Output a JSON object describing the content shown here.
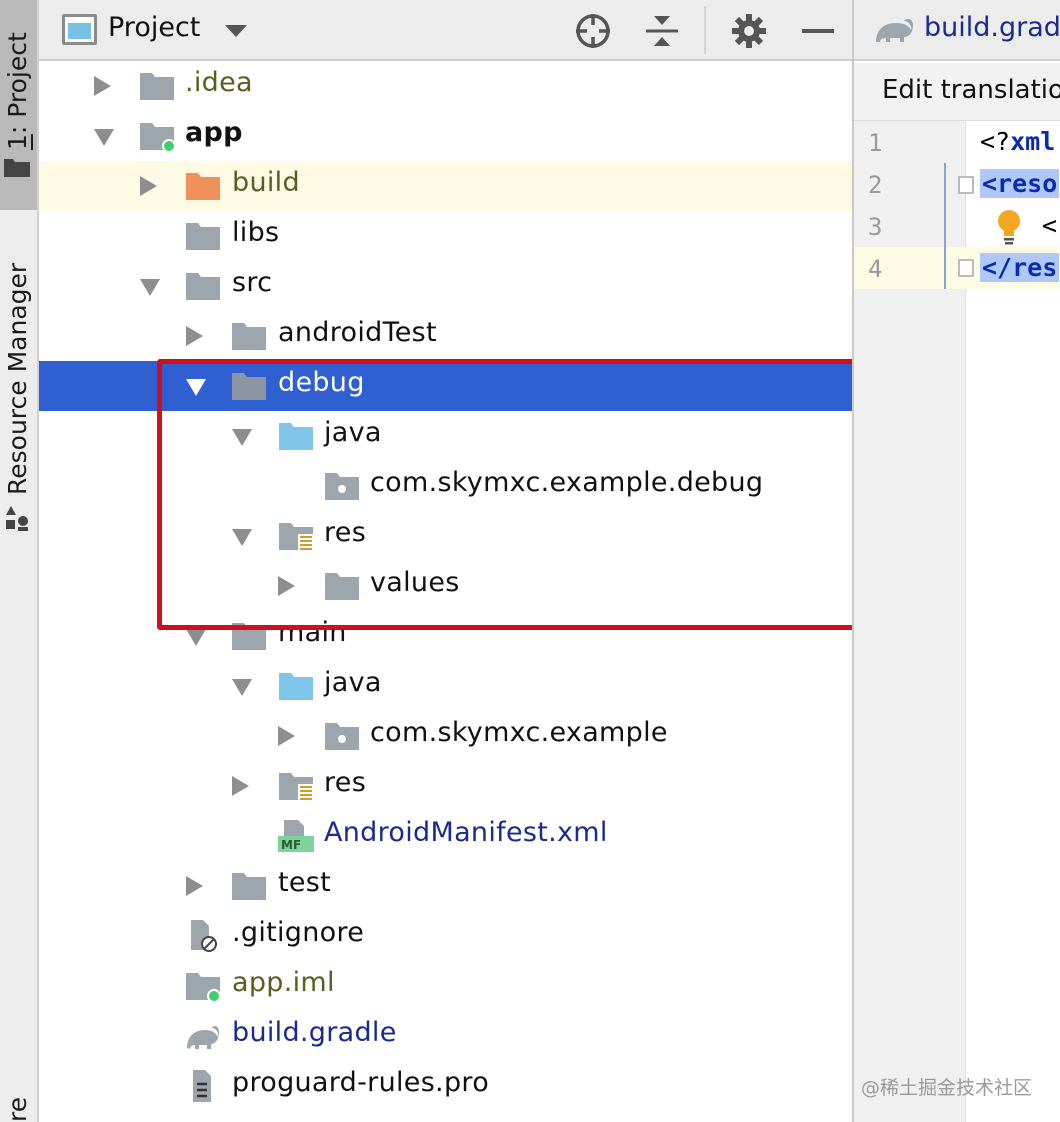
{
  "left_strip": {
    "project_tab": "1: Project",
    "project_tab_mnemonic": "1",
    "project_tab_rest": ": Project",
    "resource_manager_tab": "Resource Manager",
    "bottom_tab_fragment": "re"
  },
  "panel": {
    "title": "Project",
    "buttons": [
      "locate-icon",
      "collapse-all-icon",
      "gear-icon",
      "hide-icon"
    ]
  },
  "tree": {
    "rows": [
      {
        "label": ".idea",
        "icon": "folder-icon",
        "arrow": "collapsed"
      },
      {
        "label": "app",
        "icon": "module-folder-icon",
        "arrow": "expanded"
      },
      {
        "label": "build",
        "icon": "excluded-folder-icon",
        "arrow": "collapsed"
      },
      {
        "label": "libs",
        "icon": "folder-icon",
        "arrow": "none"
      },
      {
        "label": "src",
        "icon": "folder-icon",
        "arrow": "expanded"
      },
      {
        "label": "androidTest",
        "icon": "folder-icon",
        "arrow": "collapsed"
      },
      {
        "label": "debug",
        "icon": "folder-icon",
        "arrow": "expanded",
        "selected": true
      },
      {
        "label": "java",
        "icon": "source-folder-icon",
        "arrow": "expanded"
      },
      {
        "label": "com.skymxc.example.debug",
        "icon": "package-icon",
        "arrow": "none"
      },
      {
        "label": "res",
        "icon": "resource-folder-icon",
        "arrow": "expanded"
      },
      {
        "label": "values",
        "icon": "folder-icon",
        "arrow": "collapsed"
      },
      {
        "label": "main",
        "icon": "folder-icon",
        "arrow": "expanded"
      },
      {
        "label": "java",
        "icon": "source-folder-icon",
        "arrow": "expanded"
      },
      {
        "label": "com.skymxc.example",
        "icon": "package-icon",
        "arrow": "collapsed"
      },
      {
        "label": "res",
        "icon": "resource-folder-icon",
        "arrow": "collapsed"
      },
      {
        "label": "AndroidManifest.xml",
        "icon": "manifest-icon",
        "arrow": "none"
      },
      {
        "label": "test",
        "icon": "folder-icon",
        "arrow": "collapsed"
      },
      {
        "label": ".gitignore",
        "icon": "ignored-file-icon",
        "arrow": "none"
      },
      {
        "label": "app.iml",
        "icon": "module-file-icon",
        "arrow": "none"
      },
      {
        "label": "build.gradle",
        "icon": "gradle-icon",
        "arrow": "none"
      },
      {
        "label": "proguard-rules.pro",
        "icon": "text-file-icon",
        "arrow": "none"
      }
    ]
  },
  "editor": {
    "tab_label": "build.grad",
    "notice": "Edit translatio",
    "line_numbers": [
      "1",
      "2",
      "3",
      "4"
    ],
    "lines": [
      "<?xml",
      "<reso",
      "<",
      "</res"
    ]
  },
  "watermark": "@稀土掘金技术社区",
  "colors": {
    "selection": "#2f5fd0",
    "highlight_box": "#cc1020",
    "row_highlight": "#fdfbe4",
    "folder_gray": "#9ea6ad",
    "source_folder": "#7ec6ea",
    "excluded_folder": "#f0915a",
    "link_blue": "#1a2a8f",
    "olive_text": "#5b5e22"
  }
}
